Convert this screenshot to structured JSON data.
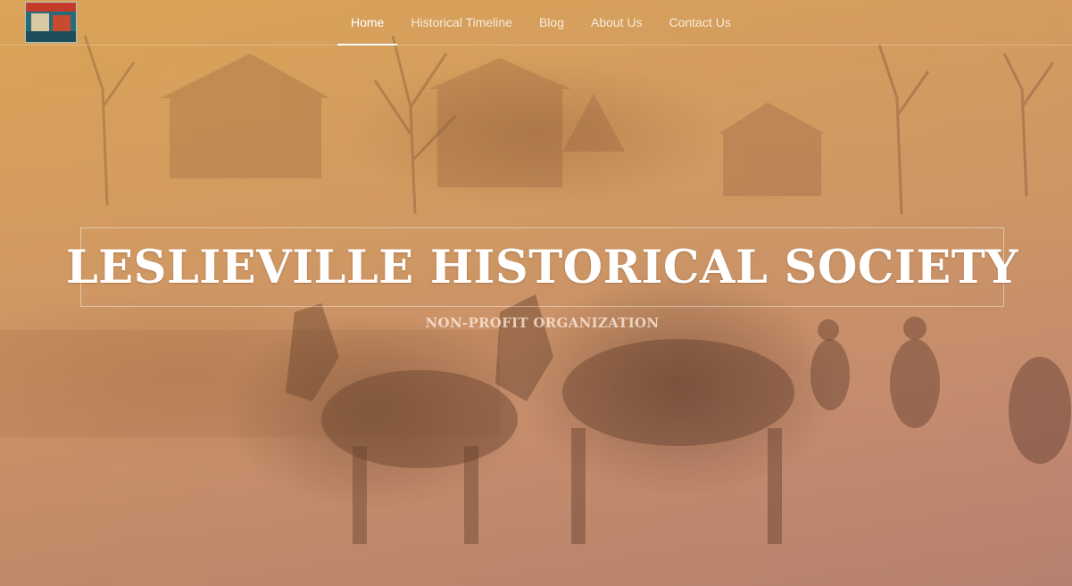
{
  "logo": {
    "alt": "Leslieville Historical Society logo"
  },
  "nav": {
    "items": [
      {
        "label": "Home",
        "active": true
      },
      {
        "label": "Historical Timeline",
        "active": false
      },
      {
        "label": "Blog",
        "active": false
      },
      {
        "label": "About Us",
        "active": false
      },
      {
        "label": "Contact Us",
        "active": false
      }
    ]
  },
  "hero": {
    "title": "LESLIEVILLE HISTORICAL SOCIETY",
    "subtitle": "NON-PROFIT ORGANIZATION"
  },
  "colors": {
    "overlay_top": "#d8a35a",
    "overlay_bottom": "#b48070",
    "text": "#ffffff"
  }
}
